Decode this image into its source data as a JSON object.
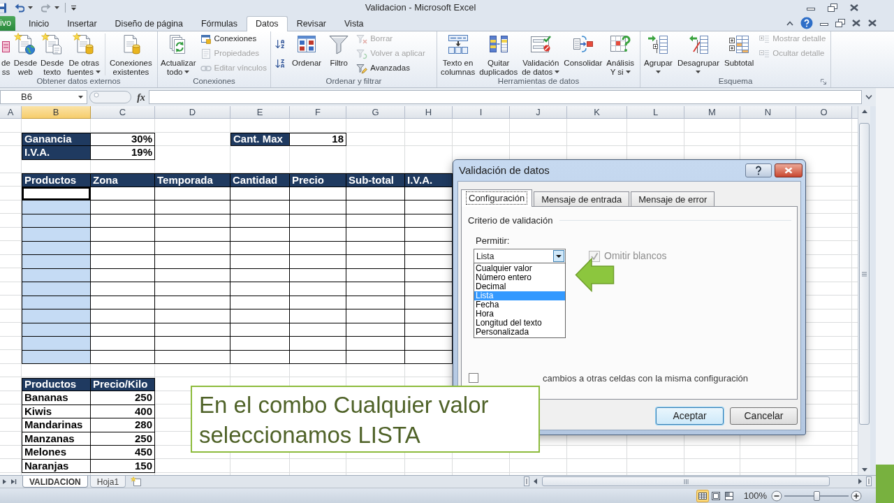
{
  "window": {
    "title": "Validacion - Microsoft Excel"
  },
  "ribbon": {
    "tabs": [
      {
        "label": "ivo",
        "kind": "file",
        "selected": false
      },
      {
        "label": "Inicio",
        "kind": "tab",
        "selected": false
      },
      {
        "label": "Insertar",
        "kind": "tab",
        "selected": false
      },
      {
        "label": "Diseño de página",
        "kind": "tab",
        "selected": false
      },
      {
        "label": "Fórmulas",
        "kind": "tab",
        "selected": false
      },
      {
        "label": "Datos",
        "kind": "tab",
        "selected": true
      },
      {
        "label": "Revisar",
        "kind": "tab",
        "selected": false
      },
      {
        "label": "Vista",
        "kind": "tab",
        "selected": false
      }
    ],
    "groups": [
      {
        "label": "Obtener datos externos",
        "controls": [
          {
            "kind": "large",
            "lines": [
              "de",
              "ss"
            ],
            "menu": false
          },
          {
            "kind": "large",
            "lines": [
              "Desde",
              "web"
            ],
            "menu": false
          },
          {
            "kind": "large",
            "lines": [
              "Desde",
              "texto"
            ],
            "menu": false
          },
          {
            "kind": "large",
            "lines": [
              "De otras",
              "fuentes"
            ],
            "menu": true
          },
          {
            "kind": "separator"
          },
          {
            "kind": "large",
            "lines": [
              "Conexiones",
              "existentes"
            ],
            "menu": false
          }
        ]
      },
      {
        "label": "Conexiones",
        "controls": [
          {
            "kind": "large",
            "lines": [
              "Actualizar",
              "todo"
            ],
            "menu": true
          },
          {
            "kind": "stack",
            "items": [
              {
                "label": "Conexiones",
                "disabled": false
              },
              {
                "label": "Propiedades",
                "disabled": true
              },
              {
                "label": "Editar vínculos",
                "disabled": true
              }
            ]
          }
        ]
      },
      {
        "label": "Ordenar y filtrar",
        "controls": [
          {
            "kind": "stack",
            "items": [
              {
                "disabled": false
              },
              {
                "disabled": false
              }
            ]
          },
          {
            "kind": "large",
            "lines": [
              "Ordenar"
            ],
            "menu": false
          },
          {
            "kind": "large",
            "lines": [
              "Filtro"
            ],
            "menu": false
          },
          {
            "kind": "stack",
            "items": [
              {
                "label": "Borrar",
                "disabled": true
              },
              {
                "label": "Volver a aplicar",
                "disabled": true
              },
              {
                "label": "Avanzadas",
                "disabled": false
              }
            ]
          }
        ]
      },
      {
        "label": "Herramientas de datos",
        "controls": [
          {
            "kind": "large",
            "lines": [
              "Texto en",
              "columnas"
            ],
            "menu": false
          },
          {
            "kind": "large",
            "lines": [
              "Quitar",
              "duplicados"
            ],
            "menu": false
          },
          {
            "kind": "large",
            "lines": [
              "Validación",
              "de datos"
            ],
            "menu": true
          },
          {
            "kind": "large",
            "lines": [
              "Consolidar"
            ],
            "menu": false
          },
          {
            "kind": "large",
            "lines": [
              "Análisis",
              "Y si"
            ],
            "menu": true
          }
        ]
      },
      {
        "label": "Esquema",
        "launcher": true,
        "controls": [
          {
            "kind": "large",
            "lines": [
              "Agrupar"
            ],
            "menu": true
          },
          {
            "kind": "large",
            "lines": [
              "Desagrupar"
            ],
            "menu": true
          },
          {
            "kind": "large",
            "lines": [
              "Subtotal"
            ],
            "menu": false
          },
          {
            "kind": "stack",
            "items": [
              {
                "label": "Mostrar detalle",
                "disabled": true
              },
              {
                "label": "Ocultar detalle",
                "disabled": true
              }
            ]
          }
        ]
      }
    ]
  },
  "formula_bar": {
    "name_box": "B6",
    "function_label": "fx"
  },
  "sheet": {
    "columns": [
      {
        "label": "A",
        "selected": false
      },
      {
        "label": "B",
        "selected": true
      },
      {
        "label": "C",
        "selected": false
      },
      {
        "label": "D",
        "selected": false
      },
      {
        "label": "E",
        "selected": false
      },
      {
        "label": "F",
        "selected": false
      },
      {
        "label": "G",
        "selected": false
      },
      {
        "label": "H",
        "selected": false
      },
      {
        "label": "I",
        "selected": false
      },
      {
        "label": "J",
        "selected": false
      },
      {
        "label": "K",
        "selected": false
      },
      {
        "label": "L",
        "selected": false
      },
      {
        "label": "M",
        "selected": false
      },
      {
        "label": "N",
        "selected": false
      },
      {
        "label": "O",
        "selected": false
      }
    ],
    "parameters": [
      {
        "label": "Ganancia",
        "value": "30%"
      },
      {
        "label": "I.V.A.",
        "value": "19%"
      }
    ],
    "limit": {
      "label": "Cant. Max",
      "value": "18"
    },
    "entry_table": {
      "columns": [
        "Productos",
        "Zona",
        "Temporada",
        "Cantidad",
        "Precio",
        "Sub-total",
        "I.V.A."
      ],
      "rows": [
        {
          "selected": true,
          "active": true
        },
        {
          "selected": true,
          "active": false
        },
        {
          "selected": true,
          "active": false
        },
        {
          "selected": true,
          "active": false
        },
        {
          "selected": true,
          "active": false
        },
        {
          "selected": true,
          "active": false
        },
        {
          "selected": true,
          "active": false
        },
        {
          "selected": true,
          "active": false
        },
        {
          "selected": true,
          "active": false
        },
        {
          "selected": true,
          "active": false
        },
        {
          "selected": true,
          "active": false
        },
        {
          "selected": true,
          "active": false
        },
        {
          "selected": true,
          "active": false
        }
      ]
    },
    "price_table": {
      "columns": [
        "Productos",
        "Precio/Kilo"
      ],
      "rows": [
        {
          "product": "Bananas",
          "price": "250"
        },
        {
          "product": "Kiwis",
          "price": "400"
        },
        {
          "product": "Mandarinas",
          "price": "280"
        },
        {
          "product": "Manzanas",
          "price": "250"
        },
        {
          "product": "Melones",
          "price": "450"
        },
        {
          "product": "Naranjas",
          "price": "150"
        }
      ]
    }
  },
  "sheet_tabs": [
    {
      "label": "VALIDACION",
      "selected": true
    },
    {
      "label": "Hoja1",
      "selected": false
    }
  ],
  "dialog": {
    "title": "Validación de datos",
    "tabs": [
      {
        "label": "Configuración",
        "selected": true
      },
      {
        "label": "Mensaje de entrada",
        "selected": false
      },
      {
        "label": "Mensaje de error",
        "selected": false
      }
    ],
    "section_title": "Criterio de validación",
    "allow": {
      "label": "Permitir:",
      "value": "Lista",
      "expanded": true,
      "options": [
        {
          "label": "Cualquier valor",
          "selected": false
        },
        {
          "label": "Número entero",
          "selected": false
        },
        {
          "label": "Decimal",
          "selected": false
        },
        {
          "label": "Lista",
          "selected": true
        },
        {
          "label": "Fecha",
          "selected": false
        },
        {
          "label": "Hora",
          "selected": false
        },
        {
          "label": "Longitud del texto",
          "selected": false
        },
        {
          "label": "Personalizada",
          "selected": false
        }
      ]
    },
    "ignore_blank": {
      "label": "Omitir blancos",
      "checked": true,
      "disabled": true
    },
    "apply_to_all": {
      "label": "cambios a otras celdas con la misma configuración",
      "checked": false
    },
    "buttons": [
      {
        "label": "Aceptar",
        "default": true
      },
      {
        "label": "Cancelar",
        "default": false
      }
    ]
  },
  "callout": {
    "text": "En el combo Cualquier valor seleccionamos LISTA"
  },
  "status_bar": {
    "views": [
      {
        "selected": true
      },
      {
        "selected": false
      },
      {
        "selected": false
      }
    ],
    "zoom": {
      "reading": "100%",
      "level": 0.5
    }
  }
}
